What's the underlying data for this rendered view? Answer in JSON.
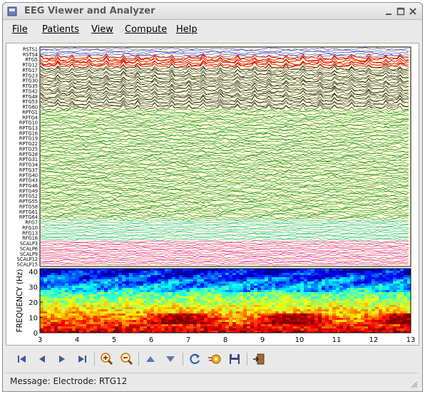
{
  "window": {
    "title": "EEG Viewer and Analyzer"
  },
  "menu": {
    "items": [
      "File",
      "Patients",
      "View",
      "Compute",
      "Help"
    ]
  },
  "eeg": {
    "channel_labels": [
      "RSTS1",
      "RSTS4",
      "RTG5",
      "RTG12",
      "RTG17",
      "RTG23",
      "RTG30",
      "RTG35",
      "RTG42",
      "RTG48",
      "RTG53",
      "RTG60",
      "RPTG1",
      "RPTG4",
      "RPTG10",
      "RPTG13",
      "RPTG16",
      "RPTG19",
      "RPTG22",
      "RPTG25",
      "RPTG28",
      "RPTG31",
      "RPTG34",
      "RPTG37",
      "RPTG40",
      "RPTG43",
      "RPTG46",
      "RPTG49",
      "RPTG52",
      "RPTG55",
      "RPTG58",
      "RPTG61",
      "RPTG64",
      "RFG7",
      "RFG10",
      "RFG13",
      "RFG16",
      "SCALP3",
      "SCALP6",
      "SCALP9",
      "SCALP12",
      "SCALP15"
    ],
    "group_colors": {
      "blue": "#1a1aff",
      "red": "#e00000",
      "black": "#000000",
      "green": "#008000",
      "cyan": "#00b0b0",
      "magenta": "#e000c0",
      "background": "#ffffd8"
    },
    "highlighted_channel": "RTG12"
  },
  "spectrogram": {
    "ylabel": "FREQUENCY (Hz)",
    "y_ticks": [
      "0",
      "10",
      "20",
      "30",
      "40"
    ],
    "x_ticks": [
      "3",
      "4",
      "5",
      "6",
      "7",
      "8",
      "9",
      "10",
      "11",
      "12",
      "13"
    ]
  },
  "toolbar": {
    "buttons": [
      "first-icon",
      "previous-icon",
      "next-icon",
      "last-icon",
      "zoom-in-icon",
      "zoom-out-icon",
      "up-icon",
      "down-icon",
      "refresh-icon",
      "compute-icon",
      "save-icon",
      "exit-icon"
    ]
  },
  "status": {
    "message": "Message: Electrode: RTG12"
  }
}
